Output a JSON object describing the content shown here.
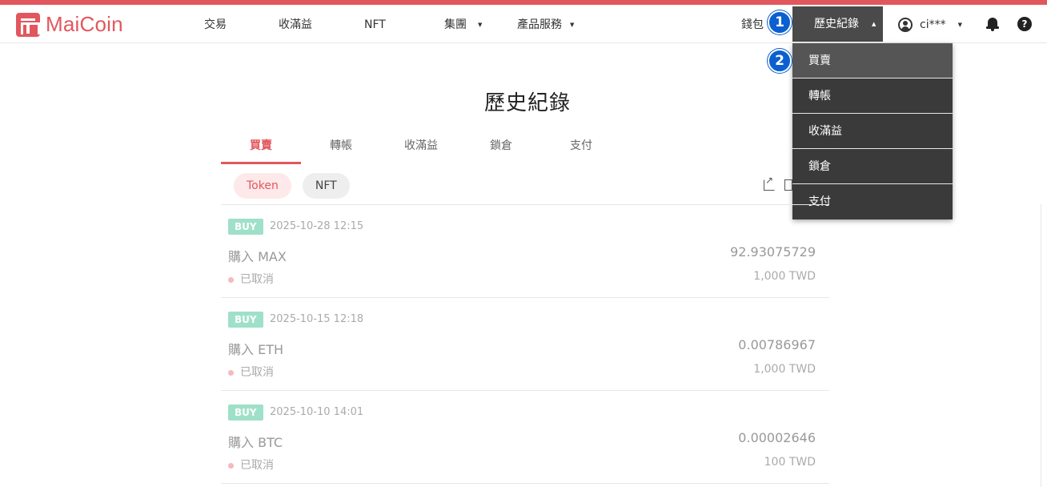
{
  "brand": {
    "name": "MaiCoin",
    "color": "#e2575e"
  },
  "nav": {
    "items": [
      {
        "label": "交易"
      },
      {
        "label": "收滿益"
      },
      {
        "label": "NFT"
      },
      {
        "label": "集團"
      },
      {
        "label": "產品服務"
      }
    ],
    "wallet": "錢包",
    "history": "歷史紀錄",
    "user": "ci***",
    "icons": [
      "user-icon",
      "bell-icon",
      "help-icon"
    ]
  },
  "annotations": {
    "first": "1",
    "second": "2"
  },
  "dropdown": {
    "items": [
      {
        "label": "買賣"
      },
      {
        "label": "轉帳"
      },
      {
        "label": "收滿益"
      },
      {
        "label": "鎖倉"
      },
      {
        "label": "支付"
      }
    ],
    "active_index": 0
  },
  "page": {
    "title": "歷史紀錄"
  },
  "tabs": [
    {
      "label": "買賣"
    },
    {
      "label": "轉帳"
    },
    {
      "label": "收滿益"
    },
    {
      "label": "鎖倉"
    },
    {
      "label": "支付"
    }
  ],
  "chips": [
    {
      "label": "Token"
    },
    {
      "label": "NFT"
    }
  ],
  "transactions": [
    {
      "tag": "BUY",
      "date": "2025-10-28 12:15",
      "title": "購入 MAX",
      "status": "已取消",
      "amount": "92.93075729",
      "twd": "1,000 TWD"
    },
    {
      "tag": "BUY",
      "date": "2025-10-15 12:18",
      "title": "購入 ETH",
      "status": "已取消",
      "amount": "0.00786967",
      "twd": "1,000 TWD"
    },
    {
      "tag": "BUY",
      "date": "2025-10-10 14:01",
      "title": "購入 BTC",
      "status": "已取消",
      "amount": "0.00002646",
      "twd": "100 TWD"
    }
  ]
}
